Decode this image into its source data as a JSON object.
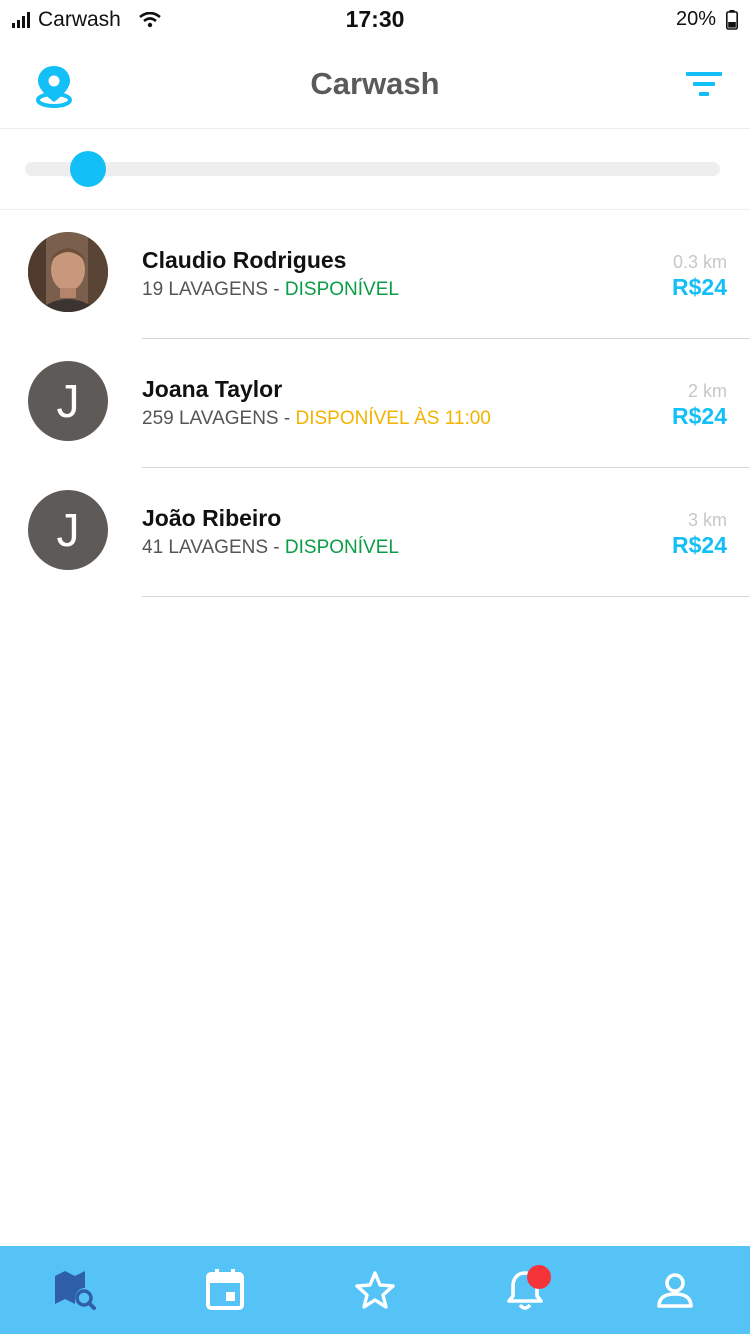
{
  "status_bar": {
    "carrier": "Carwash",
    "time": "17:30",
    "battery": "20%"
  },
  "header": {
    "title": "Carwash",
    "left_icon": "location-pin-icon",
    "right_icon": "filter-icon"
  },
  "slider": {
    "value_fraction": 0.09
  },
  "washers": [
    {
      "name": "Claudio Rodrigues",
      "washes": "19 LAVAGENS",
      "separator": " - ",
      "availability": "DISPONÍVEL",
      "availability_color": "#0a9d45",
      "distance": "0.3 km",
      "price": "R$24",
      "avatar_initial": "",
      "has_photo": true
    },
    {
      "name": "Joana Taylor",
      "washes": "259 LAVAGENS",
      "separator": " - ",
      "availability": "DISPONÍVEL ÀS 11:00",
      "availability_color": "#f2b300",
      "distance": "2 km",
      "price": "R$24",
      "avatar_initial": "J",
      "has_photo": false
    },
    {
      "name": "João Ribeiro",
      "washes": "41 LAVAGENS",
      "separator": " - ",
      "availability": "DISPONÍVEL",
      "availability_color": "#0a9d45",
      "distance": "3 km",
      "price": "R$24",
      "avatar_initial": "J",
      "has_photo": false
    }
  ],
  "tabbar": {
    "background": "#56c3f6",
    "tabs": [
      {
        "icon": "map-search-icon",
        "active": true
      },
      {
        "icon": "calendar-icon",
        "active": false
      },
      {
        "icon": "star-icon",
        "active": false
      },
      {
        "icon": "bell-icon",
        "active": false,
        "badge": true
      },
      {
        "icon": "user-icon",
        "active": false
      }
    ]
  },
  "colors": {
    "accent": "#12bff6",
    "available": "#0a9d45",
    "scheduled": "#f2b300",
    "badge": "#f5343a"
  }
}
